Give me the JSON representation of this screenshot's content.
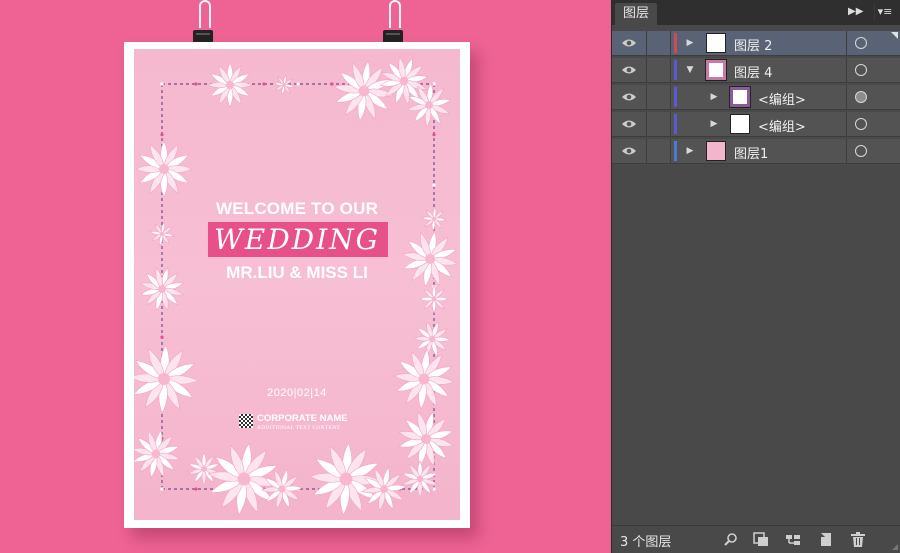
{
  "poster": {
    "welcome": "WELCOME TO OUR",
    "wedding": "WEDDING",
    "couple": "MR.LIU & MISS LI",
    "date": "2020|02|14",
    "corporate_name": "CORPORATE NAME",
    "additional_text": "ADDITIONAL TEXT CONTENT"
  },
  "panel": {
    "tab": "图层",
    "layers": [
      {
        "name": "图层 2",
        "expander": "▶",
        "color": "#d14a5a",
        "selected": true,
        "thumb": "white"
      },
      {
        "name": "图层 4",
        "expander": "▼",
        "color": "#5a5ad6",
        "selected": false,
        "thumb": "frame"
      },
      {
        "name": "<编组>",
        "expander": "▶",
        "color": "#5a5ad6",
        "selected": false,
        "thumb": "frame"
      },
      {
        "name": "<编组>",
        "expander": "▶",
        "color": "#5a5ad6",
        "selected": false,
        "thumb": "white"
      },
      {
        "name": "图层1",
        "expander": "▶",
        "color": "#4a7ad6",
        "selected": false,
        "thumb": "pink"
      }
    ],
    "footer_count": "3 个图层"
  },
  "colors": {
    "background": "#ee6393",
    "poster_pink": "#f5b8cf",
    "wedding_box": "#e8508a",
    "panel": "#494949",
    "selected_row": "#5a6375"
  }
}
